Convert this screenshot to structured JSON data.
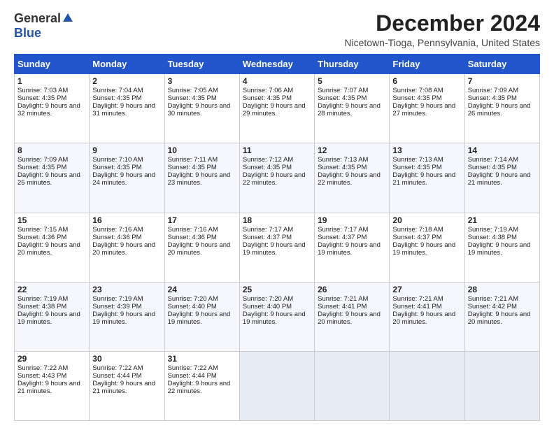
{
  "logo": {
    "general": "General",
    "blue": "Blue"
  },
  "title": "December 2024",
  "location": "Nicetown-Tioga, Pennsylvania, United States",
  "days_of_week": [
    "Sunday",
    "Monday",
    "Tuesday",
    "Wednesday",
    "Thursday",
    "Friday",
    "Saturday"
  ],
  "weeks": [
    [
      {
        "day": 1,
        "sunrise": "7:03 AM",
        "sunset": "4:35 PM",
        "daylight": "9 hours and 32 minutes."
      },
      {
        "day": 2,
        "sunrise": "7:04 AM",
        "sunset": "4:35 PM",
        "daylight": "9 hours and 31 minutes."
      },
      {
        "day": 3,
        "sunrise": "7:05 AM",
        "sunset": "4:35 PM",
        "daylight": "9 hours and 30 minutes."
      },
      {
        "day": 4,
        "sunrise": "7:06 AM",
        "sunset": "4:35 PM",
        "daylight": "9 hours and 29 minutes."
      },
      {
        "day": 5,
        "sunrise": "7:07 AM",
        "sunset": "4:35 PM",
        "daylight": "9 hours and 28 minutes."
      },
      {
        "day": 6,
        "sunrise": "7:08 AM",
        "sunset": "4:35 PM",
        "daylight": "9 hours and 27 minutes."
      },
      {
        "day": 7,
        "sunrise": "7:09 AM",
        "sunset": "4:35 PM",
        "daylight": "9 hours and 26 minutes."
      }
    ],
    [
      {
        "day": 8,
        "sunrise": "7:09 AM",
        "sunset": "4:35 PM",
        "daylight": "9 hours and 25 minutes."
      },
      {
        "day": 9,
        "sunrise": "7:10 AM",
        "sunset": "4:35 PM",
        "daylight": "9 hours and 24 minutes."
      },
      {
        "day": 10,
        "sunrise": "7:11 AM",
        "sunset": "4:35 PM",
        "daylight": "9 hours and 23 minutes."
      },
      {
        "day": 11,
        "sunrise": "7:12 AM",
        "sunset": "4:35 PM",
        "daylight": "9 hours and 22 minutes."
      },
      {
        "day": 12,
        "sunrise": "7:13 AM",
        "sunset": "4:35 PM",
        "daylight": "9 hours and 22 minutes."
      },
      {
        "day": 13,
        "sunrise": "7:13 AM",
        "sunset": "4:35 PM",
        "daylight": "9 hours and 21 minutes."
      },
      {
        "day": 14,
        "sunrise": "7:14 AM",
        "sunset": "4:35 PM",
        "daylight": "9 hours and 21 minutes."
      }
    ],
    [
      {
        "day": 15,
        "sunrise": "7:15 AM",
        "sunset": "4:36 PM",
        "daylight": "9 hours and 20 minutes."
      },
      {
        "day": 16,
        "sunrise": "7:16 AM",
        "sunset": "4:36 PM",
        "daylight": "9 hours and 20 minutes."
      },
      {
        "day": 17,
        "sunrise": "7:16 AM",
        "sunset": "4:36 PM",
        "daylight": "9 hours and 20 minutes."
      },
      {
        "day": 18,
        "sunrise": "7:17 AM",
        "sunset": "4:37 PM",
        "daylight": "9 hours and 19 minutes."
      },
      {
        "day": 19,
        "sunrise": "7:17 AM",
        "sunset": "4:37 PM",
        "daylight": "9 hours and 19 minutes."
      },
      {
        "day": 20,
        "sunrise": "7:18 AM",
        "sunset": "4:37 PM",
        "daylight": "9 hours and 19 minutes."
      },
      {
        "day": 21,
        "sunrise": "7:19 AM",
        "sunset": "4:38 PM",
        "daylight": "9 hours and 19 minutes."
      }
    ],
    [
      {
        "day": 22,
        "sunrise": "7:19 AM",
        "sunset": "4:38 PM",
        "daylight": "9 hours and 19 minutes."
      },
      {
        "day": 23,
        "sunrise": "7:19 AM",
        "sunset": "4:39 PM",
        "daylight": "9 hours and 19 minutes."
      },
      {
        "day": 24,
        "sunrise": "7:20 AM",
        "sunset": "4:40 PM",
        "daylight": "9 hours and 19 minutes."
      },
      {
        "day": 25,
        "sunrise": "7:20 AM",
        "sunset": "4:40 PM",
        "daylight": "9 hours and 19 minutes."
      },
      {
        "day": 26,
        "sunrise": "7:21 AM",
        "sunset": "4:41 PM",
        "daylight": "9 hours and 20 minutes."
      },
      {
        "day": 27,
        "sunrise": "7:21 AM",
        "sunset": "4:41 PM",
        "daylight": "9 hours and 20 minutes."
      },
      {
        "day": 28,
        "sunrise": "7:21 AM",
        "sunset": "4:42 PM",
        "daylight": "9 hours and 20 minutes."
      }
    ],
    [
      {
        "day": 29,
        "sunrise": "7:22 AM",
        "sunset": "4:43 PM",
        "daylight": "9 hours and 21 minutes."
      },
      {
        "day": 30,
        "sunrise": "7:22 AM",
        "sunset": "4:44 PM",
        "daylight": "9 hours and 21 minutes."
      },
      {
        "day": 31,
        "sunrise": "7:22 AM",
        "sunset": "4:44 PM",
        "daylight": "9 hours and 22 minutes."
      },
      null,
      null,
      null,
      null
    ]
  ]
}
